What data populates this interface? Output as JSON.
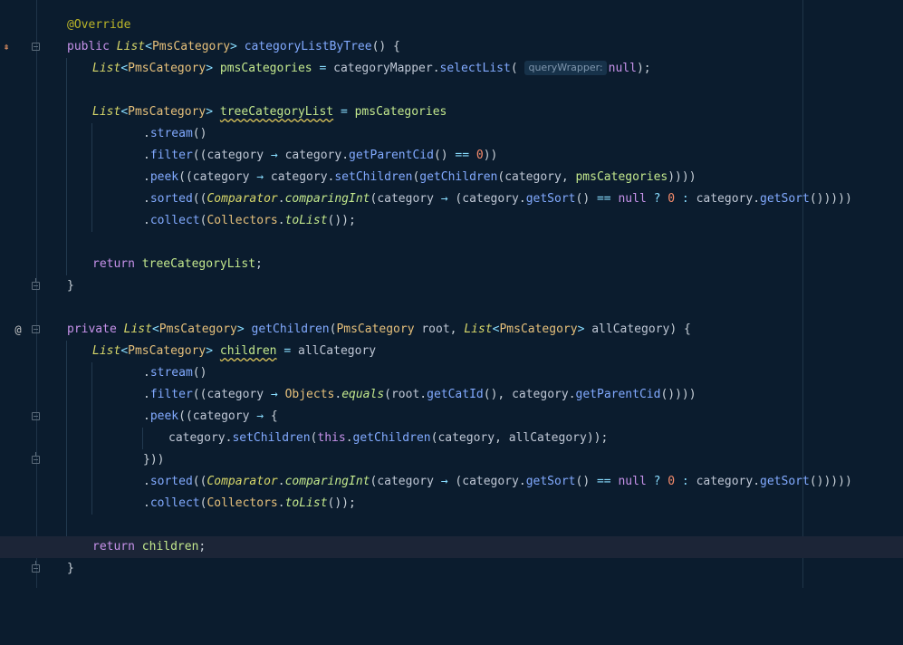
{
  "editor": {
    "language": "java",
    "inlay_hint": "queryWrapper:",
    "gutter_icons": {
      "implements": "implements-method-icon",
      "override": "@"
    },
    "code": {
      "annotation": "@Override",
      "kw_public": "public",
      "kw_private": "private",
      "kw_return": "return",
      "kw_this": "this",
      "kw_null": "null",
      "t_list": "List",
      "t_pms": "PmsCategory",
      "t_comparator": "Comparator",
      "t_collectors": "Collectors",
      "t_objects": "Objects",
      "m_categoryListByTree": "categoryListByTree",
      "m_getChildren": "getChildren",
      "m_selectList": "selectList",
      "m_stream": "stream",
      "m_filter": "filter",
      "m_peek": "peek",
      "m_sorted": "sorted",
      "m_collect": "collect",
      "m_getParentCid": "getParentCid",
      "m_setChildren": "setChildren",
      "m_comparingInt": "comparingInt",
      "m_getSort": "getSort",
      "m_toList": "toList",
      "m_equals": "equals",
      "m_getCatId": "getCatId",
      "v_pmsCategories": "pmsCategories",
      "v_categoryMapper": "categoryMapper",
      "v_treeCategoryList": "treeCategoryList",
      "v_category": "category",
      "v_root": "root",
      "v_allCategory": "allCategory",
      "v_children": "children",
      "n_zero": "0"
    }
  }
}
